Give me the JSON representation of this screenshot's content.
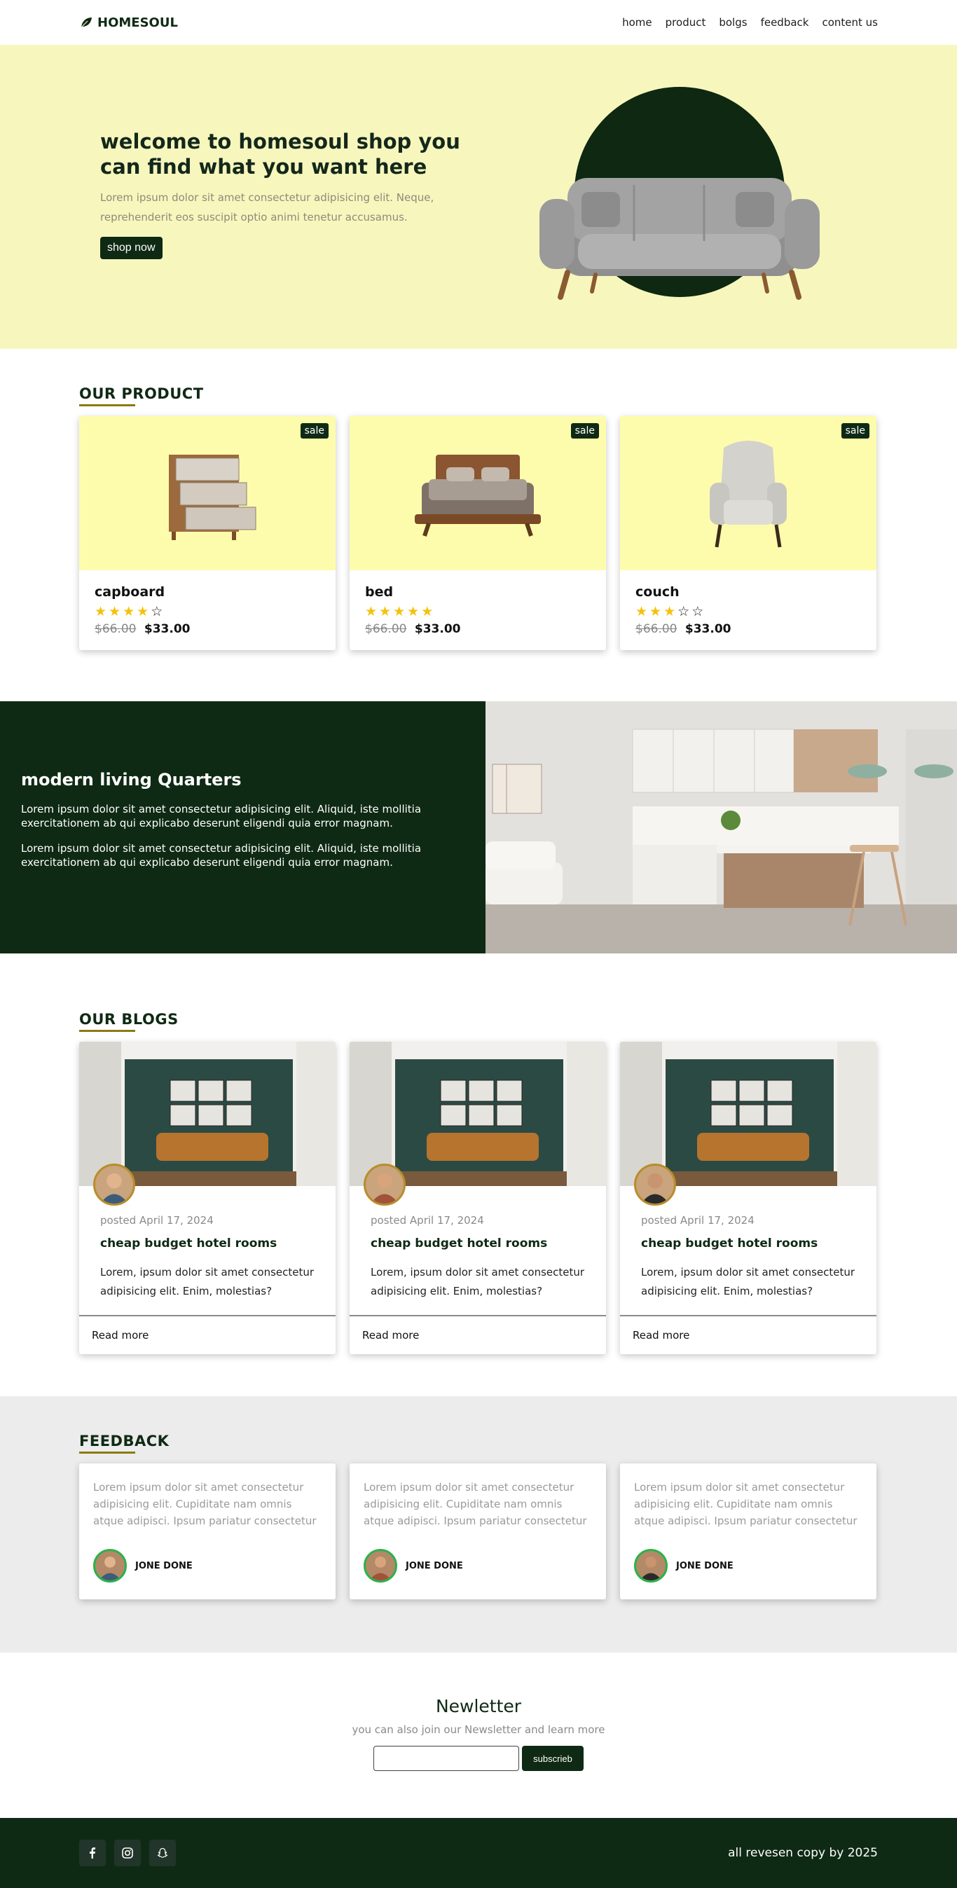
{
  "brand": "HOMESOUL",
  "nav": [
    "home",
    "product",
    "bolgs",
    "feedback",
    "content us"
  ],
  "hero": {
    "title": "welcome to homesoul shop you can find what you want here",
    "text": "Lorem ipsum dolor sit amet consectetur adipisicing elit. Neque, reprehenderit eos suscipit optio animi tenetur accusamus.",
    "button": "shop now"
  },
  "products": {
    "title": "OUR PRODUCT",
    "badge": "sale",
    "items": [
      {
        "name": "capboard",
        "rating": 4,
        "old_price": "$66.00",
        "price": "$33.00",
        "icon": "cabinet-image"
      },
      {
        "name": "bed",
        "rating": 5,
        "old_price": "$66.00",
        "price": "$33.00",
        "icon": "bed-image"
      },
      {
        "name": "couch",
        "rating": 3,
        "old_price": "$66.00",
        "price": "$33.00",
        "icon": "armchair-image"
      }
    ]
  },
  "living": {
    "title": "modern living Quarters",
    "p1": "Lorem ipsum dolor sit amet consectetur adipisicing elit. Aliquid, iste mollitia exercitationem ab qui explicabo deserunt eligendi quia error magnam.",
    "p2": "Lorem ipsum dolor sit amet consectetur adipisicing elit. Aliquid, iste mollitia exercitationem ab qui explicabo deserunt eligendi quia error magnam."
  },
  "blogs": {
    "title": "OUR BLOGS",
    "items": [
      {
        "date": "posted April 17, 2024",
        "title": "cheap budget hotel rooms",
        "text": "Lorem, ipsum dolor sit amet consectetur adipisicing elit. Enim, molestias?",
        "link": "Read more"
      },
      {
        "date": "posted April 17, 2024",
        "title": "cheap budget hotel rooms",
        "text": "Lorem, ipsum dolor sit amet consectetur adipisicing elit. Enim, molestias?",
        "link": "Read more"
      },
      {
        "date": "posted April 17, 2024",
        "title": "cheap budget hotel rooms",
        "text": "Lorem, ipsum dolor sit amet consectetur adipisicing elit. Enim, molestias?",
        "link": "Read more"
      }
    ]
  },
  "feedback": {
    "title": "FEEDBACK",
    "items": [
      {
        "text": "Lorem ipsum dolor sit amet consectetur adipisicing elit. Cupiditate nam omnis atque adipisci. Ipsum pariatur consectetur",
        "name": "JONE DONE"
      },
      {
        "text": "Lorem ipsum dolor sit amet consectetur adipisicing elit. Cupiditate nam omnis atque adipisci. Ipsum pariatur consectetur",
        "name": "JONE DONE"
      },
      {
        "text": "Lorem ipsum dolor sit amet consectetur adipisicing elit. Cupiditate nam omnis atque adipisci. Ipsum pariatur consectetur",
        "name": "JONE DONE"
      }
    ]
  },
  "newsletter": {
    "title": "Newletter",
    "text": "you can also join our Newsletter and learn more",
    "button": "subscrieb"
  },
  "footer": {
    "socials": [
      "facebook-icon",
      "instagram-icon",
      "snapchat-icon"
    ],
    "copy": "all revesen copy by 2025"
  },
  "colors": {
    "dark": "#0f2a14",
    "cream": "#f7f6bd",
    "yellow": "#fdfcac",
    "star": "#f4c20d"
  }
}
